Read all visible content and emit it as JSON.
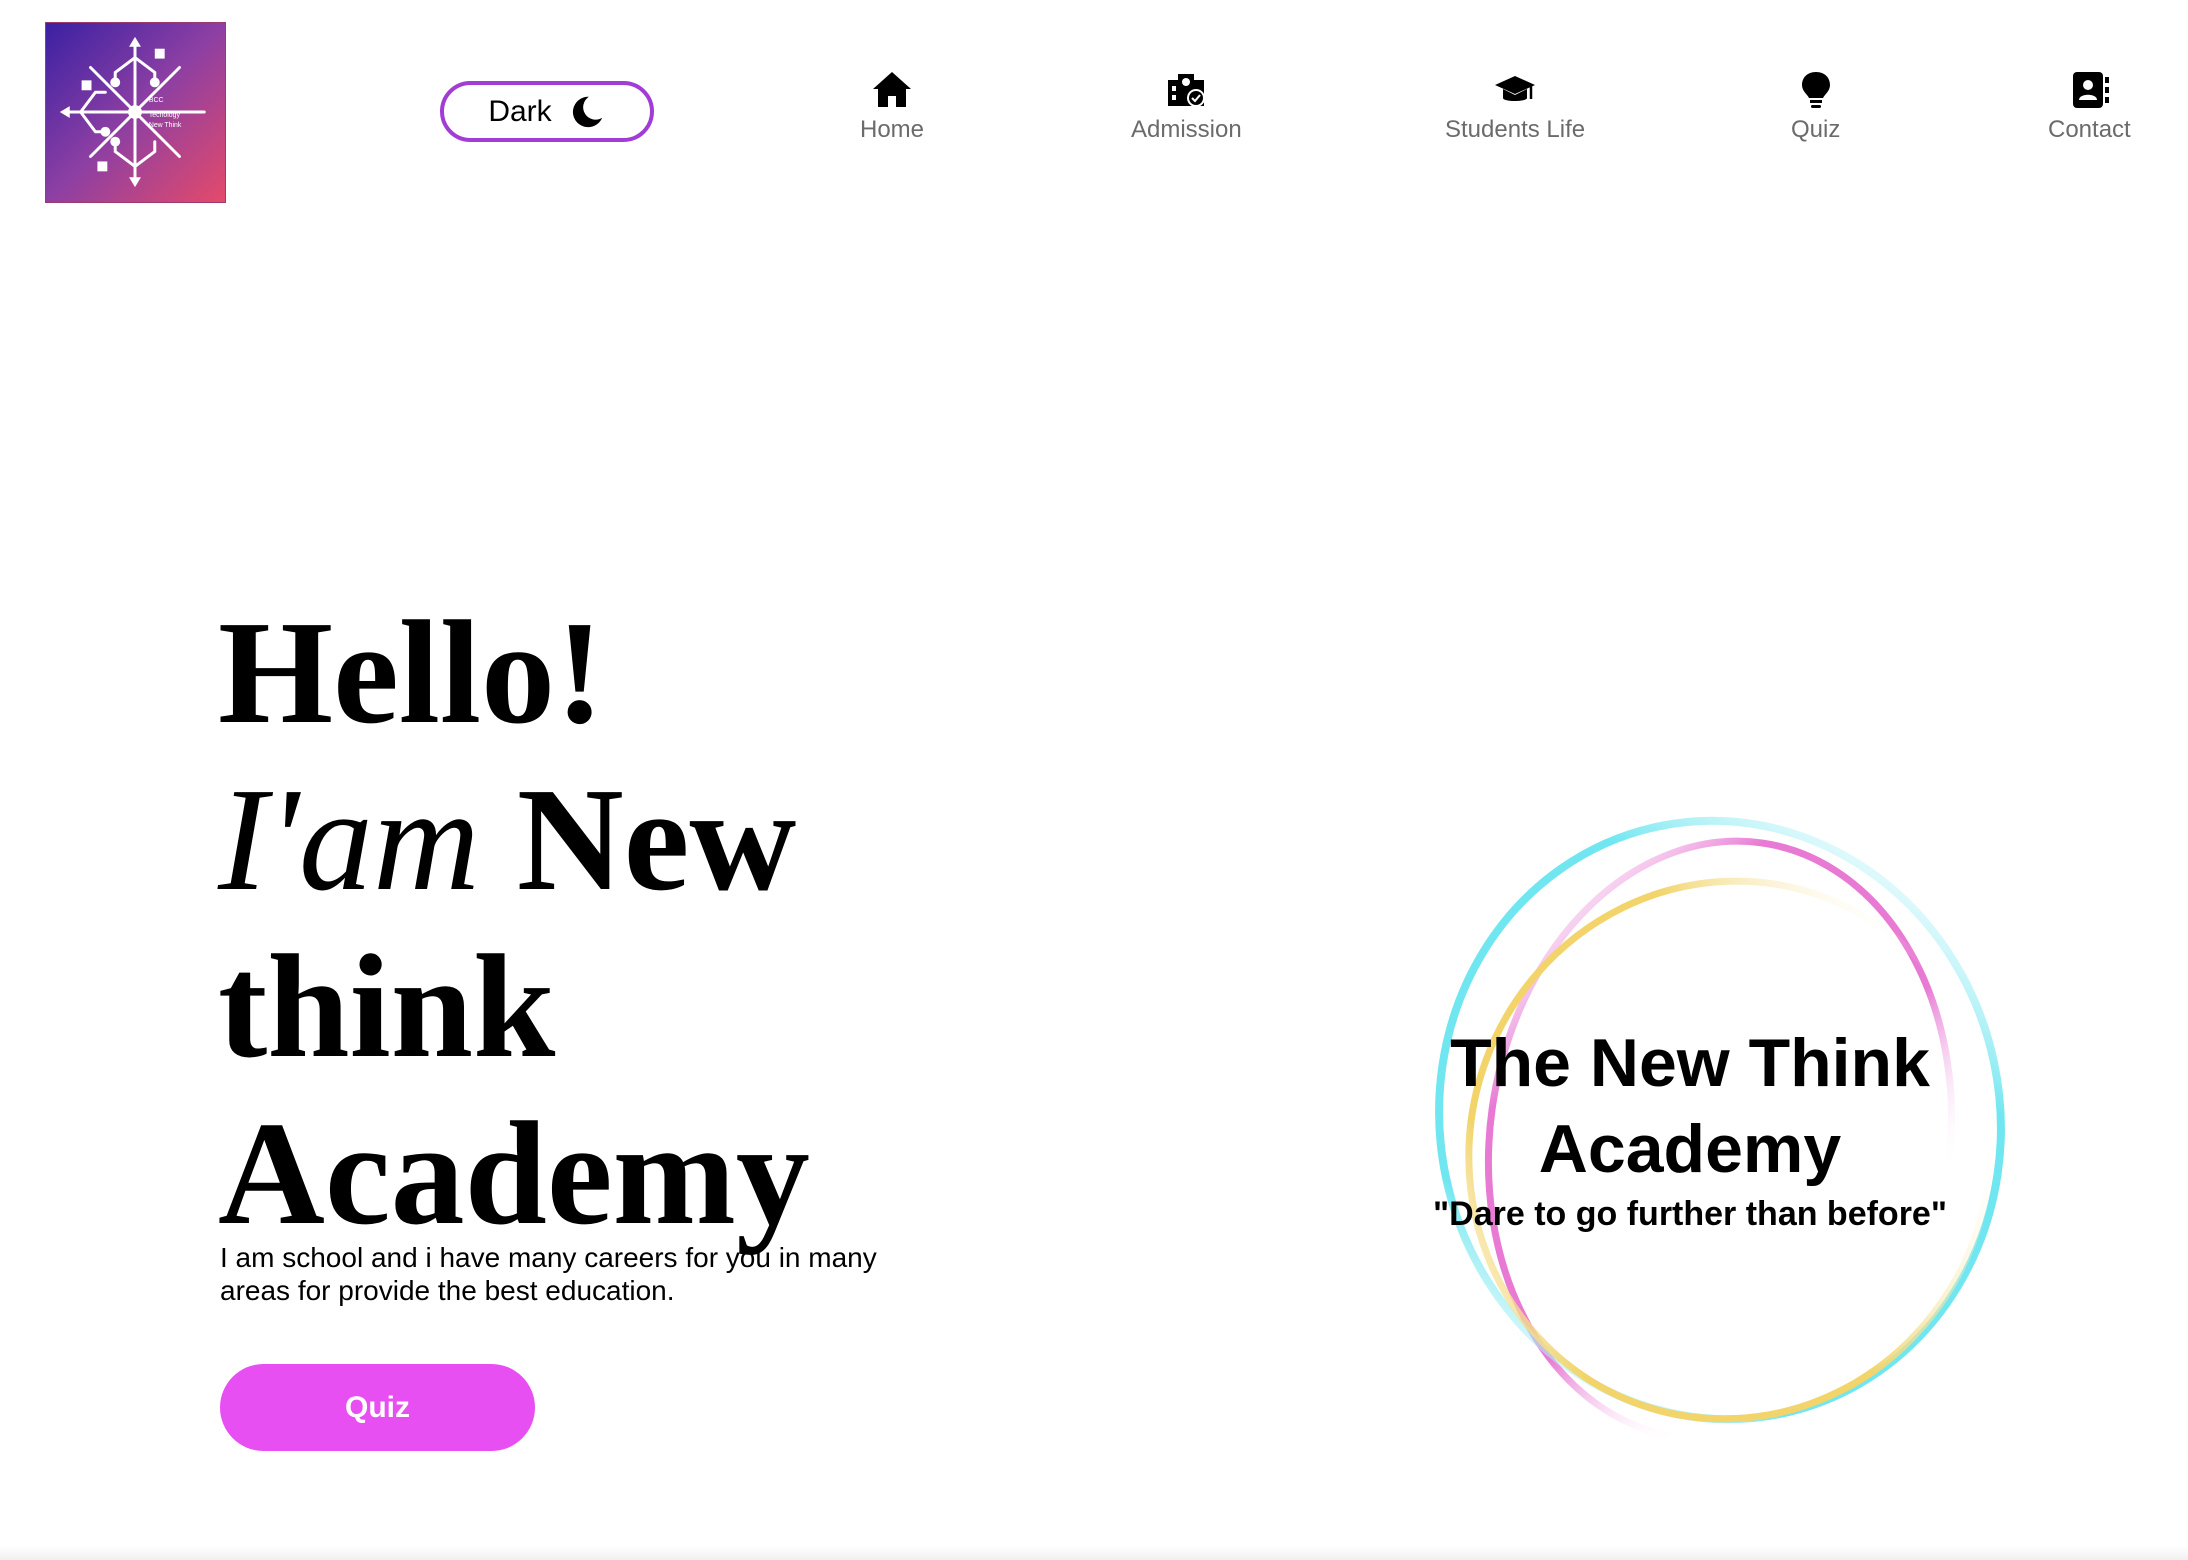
{
  "logo": {
    "icon": "circuit-snowflake-logo",
    "text_lines": [
      "BCC",
      "Tecnology",
      "New Think"
    ],
    "gradient": [
      "#3b21a3",
      "#e44a6a"
    ]
  },
  "theme_toggle": {
    "label": "Dark",
    "icon": "moon-icon",
    "border_color": "#a13cd6"
  },
  "nav": {
    "items": [
      {
        "label": "Home",
        "icon": "home-icon"
      },
      {
        "label": "Admission",
        "icon": "school-icon"
      },
      {
        "label": "Students Life",
        "icon": "graduation-cap-icon"
      },
      {
        "label": "Quiz",
        "icon": "lightbulb-icon"
      },
      {
        "label": "Contact",
        "icon": "address-book-icon"
      }
    ]
  },
  "hero": {
    "line1": "Hello!",
    "line2_italic": "I'am",
    "line2_bold": "New",
    "line3": "think",
    "line4": "Academy",
    "description": "I am school and i have many careers for you in many areas for provide the best education.",
    "button_label": "Quiz",
    "button_color": "#e74ff2"
  },
  "academy": {
    "name": "The New Think Academy",
    "motto": "\"Dare to go further than before\"",
    "ring_colors": [
      "#e87ad4",
      "#6fe6f0",
      "#f2d46a"
    ]
  }
}
